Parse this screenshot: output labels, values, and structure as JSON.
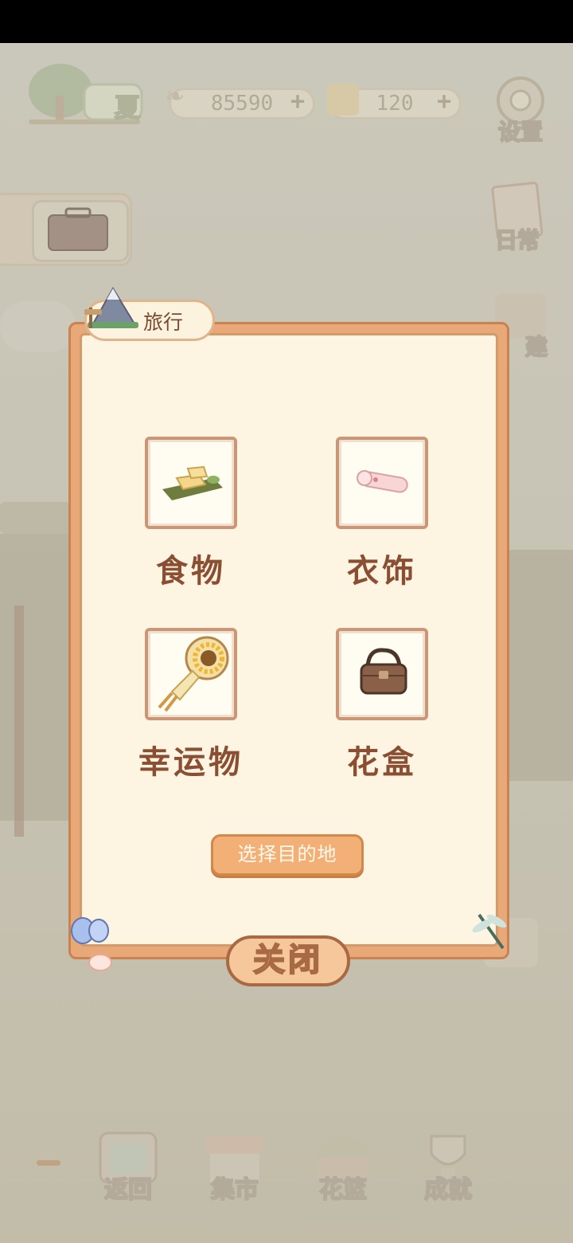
{
  "hud": {
    "season": "夏",
    "fish_count": "85590",
    "cheese_count": "120",
    "settings_label": "设置",
    "daily_label": "日常",
    "build_label": "建"
  },
  "dialog": {
    "title": "旅行",
    "items": [
      {
        "label": "食物",
        "icon": "food-plate-icon"
      },
      {
        "label": "衣饰",
        "icon": "scroll-icon"
      },
      {
        "label": "幸运物",
        "icon": "sunflower-fan-icon"
      },
      {
        "label": "花盒",
        "icon": "basket-icon"
      }
    ],
    "choose_button": "选择目的地",
    "close_button": "关闭"
  },
  "nav": {
    "items": [
      {
        "label": "返回",
        "icon": "window-icon"
      },
      {
        "label": "集市",
        "icon": "market-stall-icon"
      },
      {
        "label": "花篮",
        "icon": "flower-basket-icon"
      },
      {
        "label": "成就",
        "icon": "trophy-icon"
      }
    ]
  },
  "colors": {
    "dialog_border": "#e8a877",
    "dialog_paper": "#fdf4e1",
    "label_text": "#8a4e33",
    "button": "#f2b077"
  }
}
